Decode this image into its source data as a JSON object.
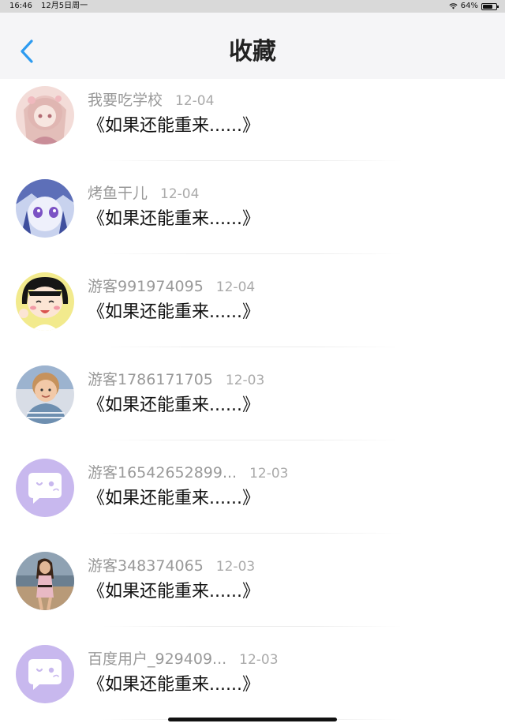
{
  "status_bar": {
    "time": "16:46",
    "date": "12月5日周一",
    "battery": "64%",
    "battery_level": 0.64,
    "icons": [
      "wifi-icon",
      "battery-icon"
    ]
  },
  "header": {
    "title": "收藏",
    "back_icon": "chevron-left-icon",
    "accent_color": "#2d9bf0"
  },
  "favorites": [
    {
      "user": "我要吃学校",
      "date": "12-04",
      "title": "《如果还能重来......》",
      "avatar": "anime-girl-pink-avatar"
    },
    {
      "user": "烤鱼干儿",
      "date": "12-04",
      "title": "《如果还能重来......》",
      "avatar": "anime-girl-blue-avatar"
    },
    {
      "user": "游客991974095",
      "date": "12-04",
      "title": "《如果还能重来......》",
      "avatar": "cartoon-girl-avatar"
    },
    {
      "user": "游客1786171705",
      "date": "12-03",
      "title": "《如果还能重来......》",
      "avatar": "child-photo-avatar"
    },
    {
      "user": "游客16542652899...",
      "date": "12-03",
      "title": "《如果还能重来......》",
      "avatar": "chat-bubble-avatar"
    },
    {
      "user": "游客348374065",
      "date": "12-03",
      "title": "《如果还能重来......》",
      "avatar": "woman-beach-photo-avatar"
    },
    {
      "user": "百度用户_929409...",
      "date": "12-03",
      "title": "《如果还能重来......》",
      "avatar": "chat-bubble-avatar"
    }
  ]
}
